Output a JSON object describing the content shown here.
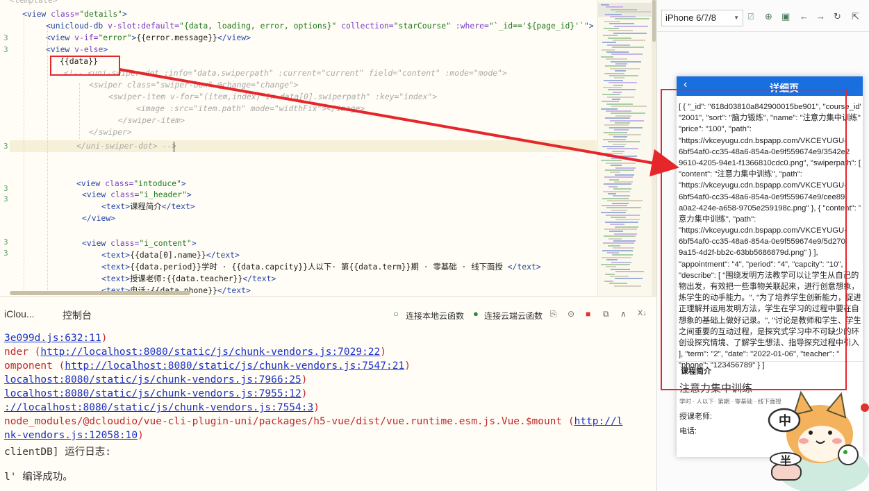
{
  "editor": {
    "gutter_marks": [
      "3",
      "3",
      "3",
      "3",
      "3",
      "3",
      "3"
    ],
    "code_lines": [
      {
        "parts": [
          [
            "c2",
            "<template>"
          ]
        ]
      },
      {
        "parts": [
          [
            "t",
            "<view "
          ],
          [
            "a",
            "class="
          ],
          [
            "s",
            "\"details\""
          ],
          [
            "t",
            ">"
          ]
        ]
      },
      {
        "parts": [
          [
            "t",
            "<unicloud-db "
          ],
          [
            "a",
            "v-slot:default="
          ],
          [
            "s",
            "\"{data, loading, error, options}\""
          ],
          [
            "a",
            " collection="
          ],
          [
            "s",
            "\"starCourse\""
          ],
          [
            "a",
            " :where="
          ],
          [
            "s",
            "\"`_id=='${page_id}'`\""
          ],
          [
            "t",
            ">"
          ]
        ]
      },
      {
        "parts": [
          [
            "t",
            "<view "
          ],
          [
            "a",
            "v-if="
          ],
          [
            "s",
            "\"error\""
          ],
          [
            "t",
            ">"
          ],
          [
            "p",
            "{{error.message}}"
          ],
          [
            "t",
            "</view>"
          ]
        ]
      },
      {
        "parts": [
          [
            "t",
            "<view "
          ],
          [
            "a",
            "v-else"
          ],
          [
            "t",
            ">"
          ]
        ]
      },
      {
        "parts": [
          [
            "p",
            "{{data}}"
          ]
        ]
      },
      {
        "parts": [
          [
            "c",
            "<!-- <uni-swiper-dot :info=\"data.swiperpath\" :current=\"current\" field=\"content\" :mode=\"mode\">"
          ]
        ]
      },
      {
        "parts": [
          [
            "c",
            "<swiper class=\"swiper-box\" @change=\"change\">"
          ]
        ]
      },
      {
        "parts": [
          [
            "c",
            "<swiper-item v-for=\"(item,index) in data[0].swiperpath\" :key=\"index\">"
          ]
        ]
      },
      {
        "parts": [
          [
            "c",
            "<image :src=\"item.path\" mode=\"widthFix\"></image>"
          ]
        ]
      },
      {
        "parts": [
          [
            "c",
            "</swiper-item>"
          ]
        ]
      },
      {
        "parts": [
          [
            "c",
            "</swiper>"
          ]
        ]
      },
      {
        "parts": [
          [
            "c",
            "</uni-swiper-dot> -->"
          ]
        ]
      },
      {
        "parts": []
      },
      {
        "parts": []
      },
      {
        "parts": [
          [
            "t",
            "<view "
          ],
          [
            "a",
            "class="
          ],
          [
            "s",
            "\"intoduce\""
          ],
          [
            "t",
            ">"
          ]
        ]
      },
      {
        "parts": [
          [
            "t",
            "<view "
          ],
          [
            "a",
            "class="
          ],
          [
            "s",
            "\"i_header\""
          ],
          [
            "t",
            ">"
          ]
        ]
      },
      {
        "parts": [
          [
            "t",
            "<text>"
          ],
          [
            "p",
            "课程简介"
          ],
          [
            "t",
            "</text>"
          ]
        ]
      },
      {
        "parts": [
          [
            "t",
            "</view>"
          ]
        ]
      },
      {
        "parts": []
      },
      {
        "parts": [
          [
            "t",
            "<view "
          ],
          [
            "a",
            "class="
          ],
          [
            "s",
            "\"i_content\""
          ],
          [
            "t",
            ">"
          ]
        ]
      },
      {
        "parts": [
          [
            "t",
            "<text>"
          ],
          [
            "p",
            "{{data[0].name}}"
          ],
          [
            "t",
            "</text>"
          ]
        ]
      },
      {
        "parts": [
          [
            "t",
            "<text>"
          ],
          [
            "p",
            "{{data.period}}学时 · {{data.capcity}}人以下· 第{{data.term}}期 · 零基础 · 线下面授 "
          ],
          [
            "t",
            "</text>"
          ]
        ]
      },
      {
        "parts": [
          [
            "t",
            "<text>"
          ],
          [
            "p",
            "授课老师:{{data.teacher}}"
          ],
          [
            "t",
            "</text>"
          ]
        ]
      },
      {
        "parts": [
          [
            "t",
            "<text>"
          ],
          [
            "p",
            "电话:{{data.phone}}"
          ],
          [
            "t",
            "</text>"
          ]
        ]
      }
    ]
  },
  "console": {
    "tabs": [
      "iClou...",
      "控制台"
    ],
    "local_cloud": "连接本地云函数",
    "remote_cloud": "连接云端云函数",
    "close_hint": "X↓",
    "log_lines": [
      {
        "pre": "",
        "link": "3e099d.js:632:11",
        "post": ")"
      },
      {
        "pre": "nder (",
        "link": "http://localhost:8080/static/js/chunk-vendors.js:7029:22",
        "post": ")"
      },
      {
        "pre": "omponent (",
        "link": "http://localhost:8080/static/js/chunk-vendors.js:7547:21",
        "post": ")"
      },
      {
        "pre": "",
        "link": "localhost:8080/static/js/chunk-vendors.js:7966:25",
        "post": ")"
      },
      {
        "pre": "",
        "link": "localhost:8080/static/js/chunk-vendors.js:7955:12",
        "post": ")"
      },
      {
        "pre": "",
        "link": "://localhost:8080/static/js/chunk-vendors.js:7554:3",
        "post": ")"
      },
      {
        "pre": "node_modules/@dcloudio/vue-cli-plugin-uni/packages/h5-vue/dist/vue.runtime.esm.js.Vue.$mount (",
        "link": "http://l",
        "post": ""
      },
      {
        "pre": "",
        "link": "nk-vendors.js:12058:10",
        "post": ")"
      }
    ],
    "runlog": "clientDB] 运行日志:",
    "compiled": "l' 编译成功。"
  },
  "preview": {
    "device": "iPhone 6/7/8",
    "nav_title": "详细页",
    "back_glyph": "‹",
    "json_lines": [
      "[ { \"_id\": \"618d03810a842900015be901\", \"course_id\":",
      "\"2001\", \"sort\": \"脑力锻炼\", \"name\": \"注意力集中训练\",",
      "\"price\": \"100\", \"path\":",
      "\"https://vkceyugu.cdn.bspapp.com/VKCEYUGU-",
      "6bf54af0-cc35-48a6-854a-0e9f559674e9/3542e2",
      "9610-4205-94e1-f1366810cdc0.png\", \"swiperpath\": [ {",
      "\"content\": \"注意力集中训练\", \"path\":",
      "\"https://vkceyugu.cdn.bspapp.com/VKCEYUGU-",
      "6bf54af0-cc35-48a6-854a-0e9f559674e9/cee89",
      "a0a2-424e-a658-9705e259198c.png\" }, { \"content\": \"注",
      "意力集中训练\", \"path\":",
      "\"https://vkceyugu.cdn.bspapp.com/VKCEYUGU-",
      "6bf54af0-cc35-48a6-854a-0e9f559674e9/5d270",
      "9a15-4d2f-bb2c-63bb5686879d.png\" } ],",
      "\"appointment\": \"4\", \"period\": \"4\", \"capcity\": \"10\",",
      "\"describe\": [ \"围绕发明方法教学可以让学生从自己的",
      "物出发，有效把一些事物关联起来，进行创意想象，",
      "炼学生的动手能力。\", \"为了培养学生创新能力，促进",
      "正理解并运用发明方法，学生在学习的过程中要在自",
      "想象的基础上做好记录。\", \"讨论是教师和学生、学生",
      "之间重要的互动过程，是探究式学习中不可缺少的环",
      "创设探究情境、了解学生想法、指导探究过程中引入",
      "], \"term\": \"2\", \"date\": \"2022-01-06\", \"teacher\": \"",
      "\"phone\": \"123456789\" } ]"
    ],
    "intro_header": "课程简介",
    "course_name": "注意力集中训练",
    "course_meta": "学时 · 人以下· 第期 · 零基础 · 线下面授",
    "teacher_label": "授课老师:",
    "phone_label": "电话:",
    "sticker_text_1": "中",
    "sticker_text_2": "半"
  },
  "colors": {
    "accent_red": "#e5262a",
    "nav_blue": "#1a6fde",
    "link_blue": "#1b31c4",
    "error_red": "#c0282a"
  }
}
